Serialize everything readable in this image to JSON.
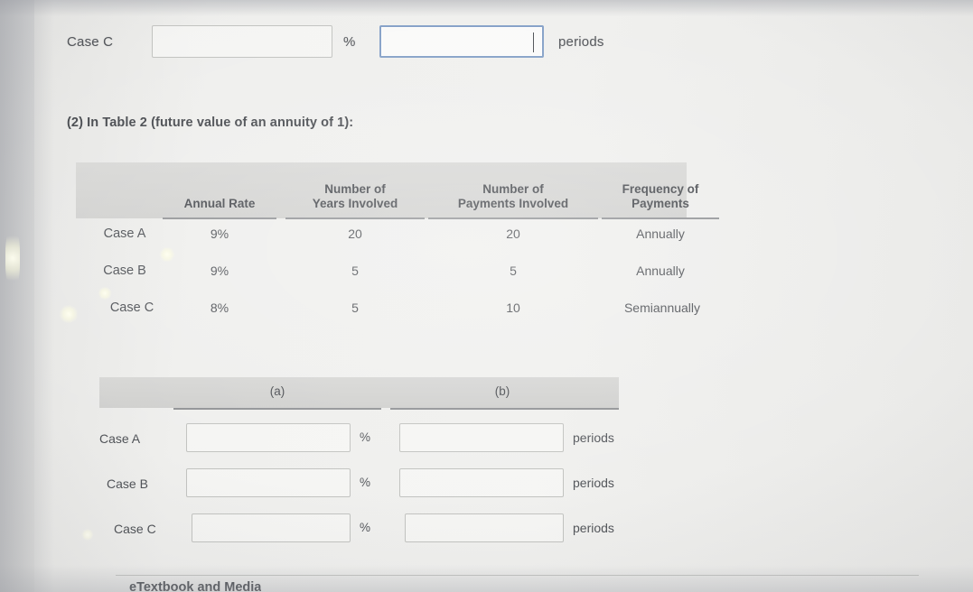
{
  "top_row": {
    "label": "Case C",
    "rate_input_value": "",
    "percent_symbol": "%",
    "periods_input_value": "",
    "periods_label": "periods",
    "focused_field": "periods-input",
    "accent_focus_color": "#7e9bc4"
  },
  "question": {
    "text": "(2) In Table 2 (future value of an annuity of 1):"
  },
  "data_table": {
    "headers": [
      "",
      "Annual Rate",
      "Number of Years Involved",
      "Number of Payments Involved",
      "Frequency of Payments"
    ],
    "header_lines": {
      "col2_line1": "Number of",
      "col2_line2": "Years Involved",
      "col3_line1": "Number of",
      "col3_line2": "Payments Involved",
      "col4_line1": "Frequency of",
      "col4_line2": "Payments",
      "col1": "Annual Rate"
    },
    "rows": [
      {
        "case": "Case A",
        "annual_rate": "9%",
        "years": "20",
        "payments": "20",
        "frequency": "Annually"
      },
      {
        "case": "Case B",
        "annual_rate": "9%",
        "years": "5",
        "payments": "5",
        "frequency": "Annually"
      },
      {
        "case": "Case C",
        "annual_rate": "8%",
        "years": "5",
        "payments": "10",
        "frequency": "Semiannually"
      }
    ],
    "header_bg": "#d3d3d1"
  },
  "answer_table": {
    "headers": [
      "(a)",
      "(b)"
    ],
    "rows": [
      {
        "case": "Case A",
        "a_value": "",
        "a_unit": "%",
        "b_value": "",
        "b_unit": "periods"
      },
      {
        "case": "Case B",
        "a_value": "",
        "a_unit": "%",
        "b_value": "",
        "b_unit": "periods"
      },
      {
        "case": "Case C",
        "a_value": "",
        "a_unit": "%",
        "b_value": "",
        "b_unit": "periods"
      }
    ],
    "header_bg": "#d1d1cf"
  },
  "footer": {
    "etextbook_link": "eTextbook and Media"
  }
}
